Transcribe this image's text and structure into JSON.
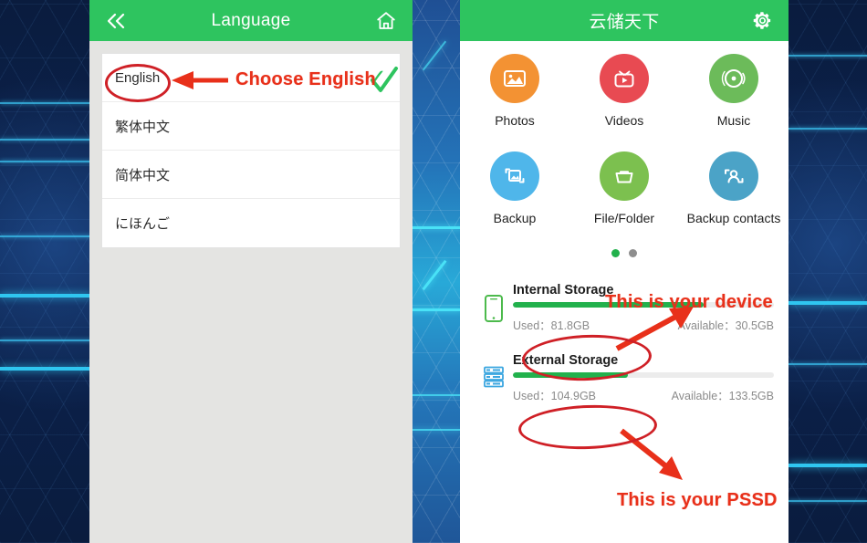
{
  "background": {
    "style": "tech-hexagon-blue",
    "dark_navy": "#0a1c3e",
    "cyan_line": "#2fc6f0",
    "mid_strip": "#28a9d8"
  },
  "language_screen": {
    "topbar": {
      "back_icon": "double-chevron-left-icon",
      "title": "Language",
      "home_icon": "home-icon",
      "bg_color": "#2ec45f"
    },
    "items": [
      {
        "label": "English",
        "selected": true,
        "check_glyph": "✓"
      },
      {
        "label": "繁体中文",
        "selected": false,
        "check_glyph": ""
      },
      {
        "label": "简体中文",
        "selected": false,
        "check_glyph": ""
      },
      {
        "label": "にほんご",
        "selected": false,
        "check_glyph": ""
      }
    ]
  },
  "app_screen": {
    "topbar": {
      "title": "云储天下",
      "settings_icon": "gear-icon",
      "bg_color": "#2ec45f"
    },
    "tiles": [
      {
        "label": "Photos",
        "icon": "photo-icon",
        "color": "#f39233"
      },
      {
        "label": "Videos",
        "icon": "tv-video-icon",
        "color": "#e84a52"
      },
      {
        "label": "Music",
        "icon": "vinyl-record-icon",
        "color": "#6cbb5a"
      },
      {
        "label": "Backup",
        "icon": "backup-photo-icon",
        "color": "#4fb6ea"
      },
      {
        "label": "File/Folder",
        "icon": "folder-icon",
        "color": "#7cc04f"
      },
      {
        "label": "Backup contacts",
        "icon": "backup-contacts-icon",
        "color": "#4ba3c7"
      }
    ],
    "pager": {
      "count": 2,
      "active_index": 0,
      "active_color": "#22b14c",
      "inactive_color": "#8e8e8e"
    },
    "storage": [
      {
        "icon": "phone-icon",
        "title": "Internal Storage",
        "used_label": "Used：81.8GB",
        "available_label": "Available：30.5GB",
        "used_gb": 81.8,
        "available_gb": 30.5,
        "fill_percent": 73,
        "fill_color": "#22b14c"
      },
      {
        "icon": "server-stack-icon",
        "title": "External Storage",
        "used_label": "Used：104.9GB",
        "available_label": "Available：133.5GB",
        "used_gb": 104.9,
        "available_gb": 133.5,
        "fill_percent": 44,
        "fill_color": "#22b14c"
      }
    ]
  },
  "annotations": {
    "color": "#e8301a",
    "ellipse_color": "#cf2026",
    "choose_english": "Choose English",
    "this_is_your_device": "This is your device",
    "this_is_your_pssd": "This is your PSSD"
  }
}
